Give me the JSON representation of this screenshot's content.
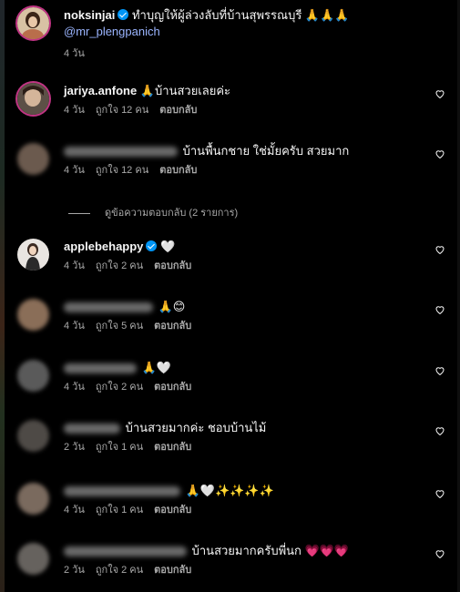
{
  "caption": {
    "username": "noksinjai",
    "text": "ทำบุญให้ผู้ล่วงลับที่บ้านสุพรรณบุรี 🙏🙏🙏",
    "mention": "@mr_plengpanich",
    "time": "4 วัน"
  },
  "view_replies_label": "ดูข้อความตอบกลับ (2 รายการ)",
  "reply_label": "ตอบกลับ",
  "comments": [
    {
      "username": "jariya.anfone",
      "text": "🙏บ้านสวยเลยค่ะ",
      "time": "4 วัน",
      "likes": "ถูกใจ 12 คน"
    },
    {
      "username": "",
      "text": "บ้านพื้นกชาย ใช่มั้ยครับ สวยมาก",
      "time": "4 วัน",
      "likes": "ถูกใจ 12 คน"
    },
    {
      "username": "applebehappy",
      "text": "🤍",
      "time": "4 วัน",
      "likes": "ถูกใจ 2 คน"
    },
    {
      "username": "",
      "text": "🙏😊",
      "time": "4 วัน",
      "likes": "ถูกใจ 5 คน"
    },
    {
      "username": "",
      "text": "🙏🤍",
      "time": "4 วัน",
      "likes": "ถูกใจ 2 คน"
    },
    {
      "username": "",
      "text": "บ้านสวยมากค่ะ ชอบบ้านไม้",
      "time": "2 วัน",
      "likes": "ถูกใจ 1 คน"
    },
    {
      "username": "",
      "text": "🙏🤍✨✨✨✨",
      "time": "4 วัน",
      "likes": "ถูกใจ 1 คน"
    },
    {
      "username": "",
      "text": "บ้านสวยมากครับพี่นก 💗💗💗",
      "time": "2 วัน",
      "likes": "ถูกใจ 2 คน"
    }
  ],
  "colors": {
    "background": "#000000",
    "text": "#f5f5f5",
    "secondary_text": "#a8a8a8",
    "mention": "#9bb5ff",
    "verified_badge": "#0095f6"
  },
  "icons": [
    "heart-icon",
    "verified-badge-icon"
  ]
}
